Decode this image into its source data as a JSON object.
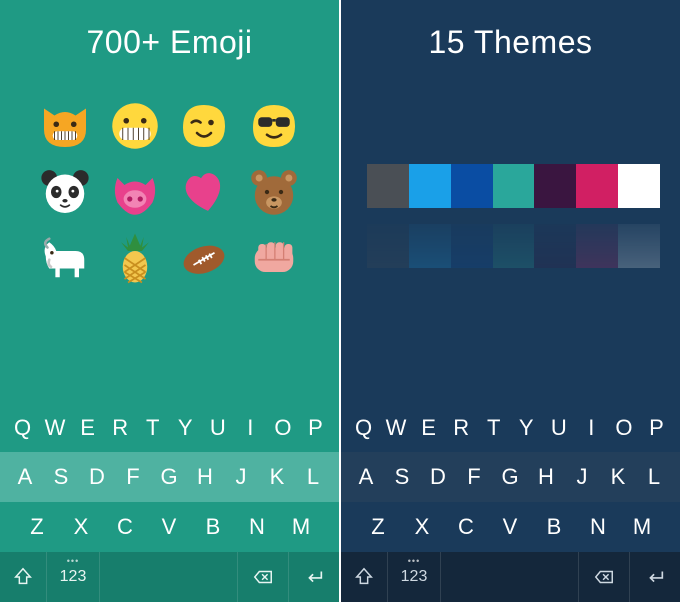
{
  "left": {
    "title": "700+ Emoji",
    "bg": "#1f9a84",
    "hl": "#4fb2a1",
    "bottom_bg": "#177e6c",
    "emoji_names": [
      "cat-grin",
      "grin",
      "wink-blob",
      "sunglasses-blob",
      "panda",
      "pig-nose",
      "heart",
      "bear",
      "goat",
      "pineapple",
      "football",
      "fist"
    ]
  },
  "right": {
    "title": "15 Themes",
    "bg": "#1a3a5a",
    "hl": "#233f5b",
    "bottom_bg": "#14273b",
    "swatches": [
      "#4a4f55",
      "#1aa0e8",
      "#0a4da3",
      "#2aa79b",
      "#3a1540",
      "#d11f63",
      "#ffffff"
    ]
  },
  "keyboard": {
    "row1": [
      "Q",
      "W",
      "E",
      "R",
      "T",
      "Y",
      "U",
      "I",
      "O",
      "P"
    ],
    "row2": [
      "A",
      "S",
      "D",
      "F",
      "G",
      "H",
      "J",
      "K",
      "L"
    ],
    "row3": [
      "Z",
      "X",
      "C",
      "V",
      "B",
      "N",
      "M"
    ],
    "num_label": "123"
  }
}
